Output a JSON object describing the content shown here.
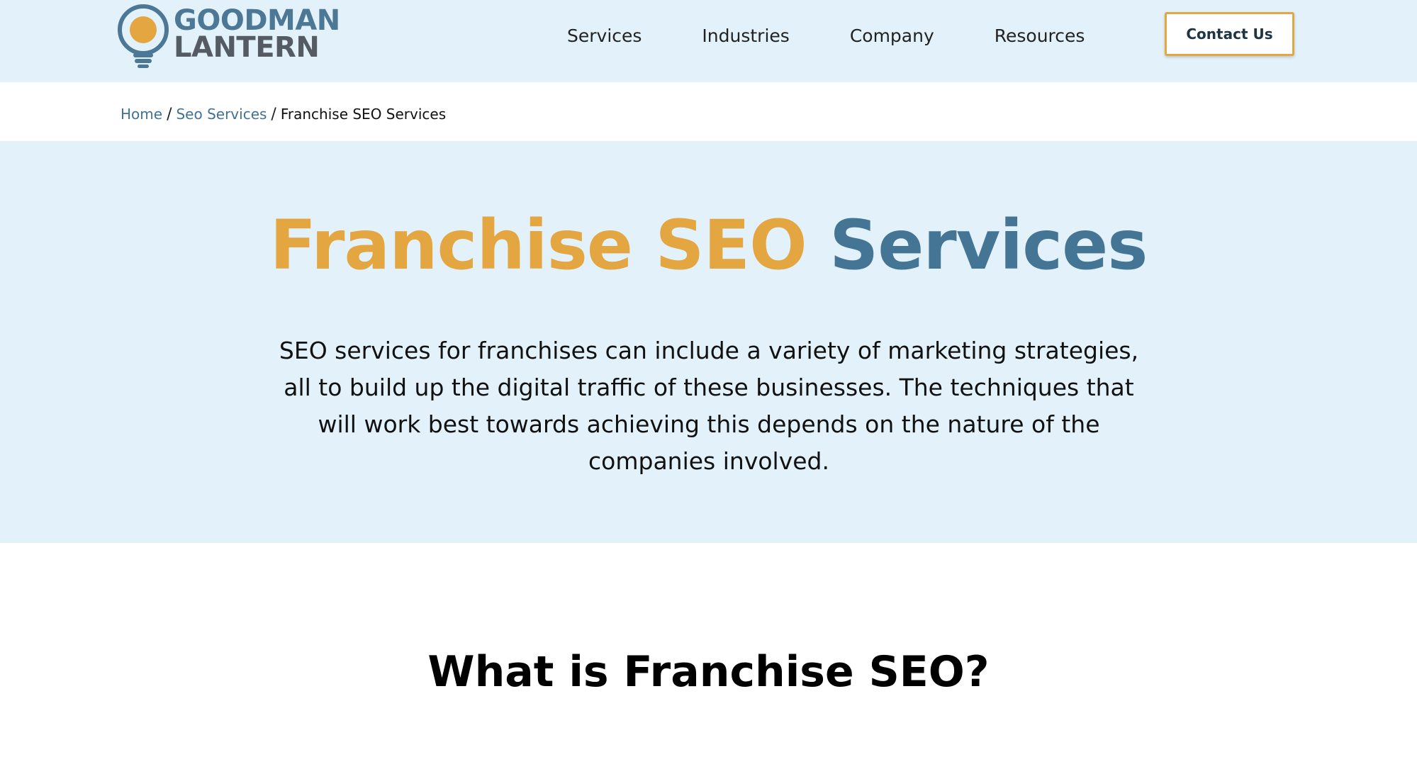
{
  "header": {
    "logo": {
      "line1": "GOODMAN",
      "line2": "LANTERN"
    },
    "nav": [
      {
        "label": "Services"
      },
      {
        "label": "Industries"
      },
      {
        "label": "Company"
      },
      {
        "label": "Resources"
      }
    ],
    "contact_label": "Contact Us"
  },
  "breadcrumb": {
    "items": [
      {
        "label": "Home"
      },
      {
        "label": "Seo Services"
      }
    ],
    "separator": "/",
    "current": "Franchise SEO Services"
  },
  "hero": {
    "title_accent": "Franchise SEO",
    "title_primary": "Services",
    "description": "SEO services for franchises can include a variety of marketing strategies, all to build up the digital traffic of these businesses. The techniques that will work best towards achieving this depends on the nature of the companies involved."
  },
  "section": {
    "title": "What is Franchise SEO?"
  },
  "colors": {
    "header_bg": "#e3f2fa",
    "accent_orange": "#e3a640",
    "primary_blue": "#457595",
    "link_blue": "#3f7296",
    "logo_gray": "#555b62",
    "button_border": "#e0a743"
  },
  "icons": {
    "logo": "lightbulb-icon"
  }
}
